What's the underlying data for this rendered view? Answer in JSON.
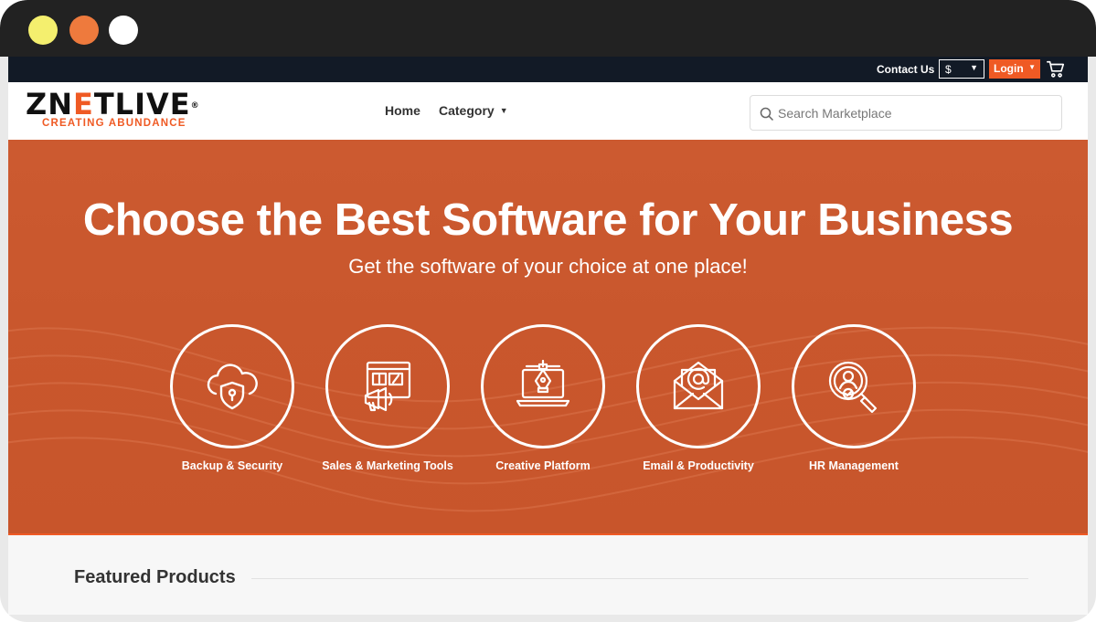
{
  "utility_bar": {
    "contact_label": "Contact Us",
    "currency_value": "$",
    "login_label": "Login"
  },
  "header": {
    "logo_text": "ZNETLIVE",
    "logo_trademark": "®",
    "logo_tagline": "CREATING ABUNDANCE",
    "nav": {
      "home_label": "Home",
      "category_label": "Category"
    },
    "search": {
      "placeholder": "Search Marketplace",
      "value": ""
    }
  },
  "hero": {
    "title": "Choose the Best Software for Your Business",
    "subtitle": "Get the software of your choice at one place!",
    "categories": [
      {
        "label": "Backup & Security",
        "icon": "cloud-shield-icon"
      },
      {
        "label": "Sales & Marketing Tools",
        "icon": "megaphone-icon"
      },
      {
        "label": "Creative Platform",
        "icon": "pen-tool-laptop-icon"
      },
      {
        "label": "Email & Productivity",
        "icon": "email-envelope-icon"
      },
      {
        "label": "HR Management",
        "icon": "people-search-icon"
      }
    ]
  },
  "featured": {
    "title": "Featured Products"
  },
  "colors": {
    "accent": "#ef5a24",
    "hero_bg": "#c9572d",
    "topbar_bg": "#121a26",
    "titlebar_bg": "#222222"
  }
}
